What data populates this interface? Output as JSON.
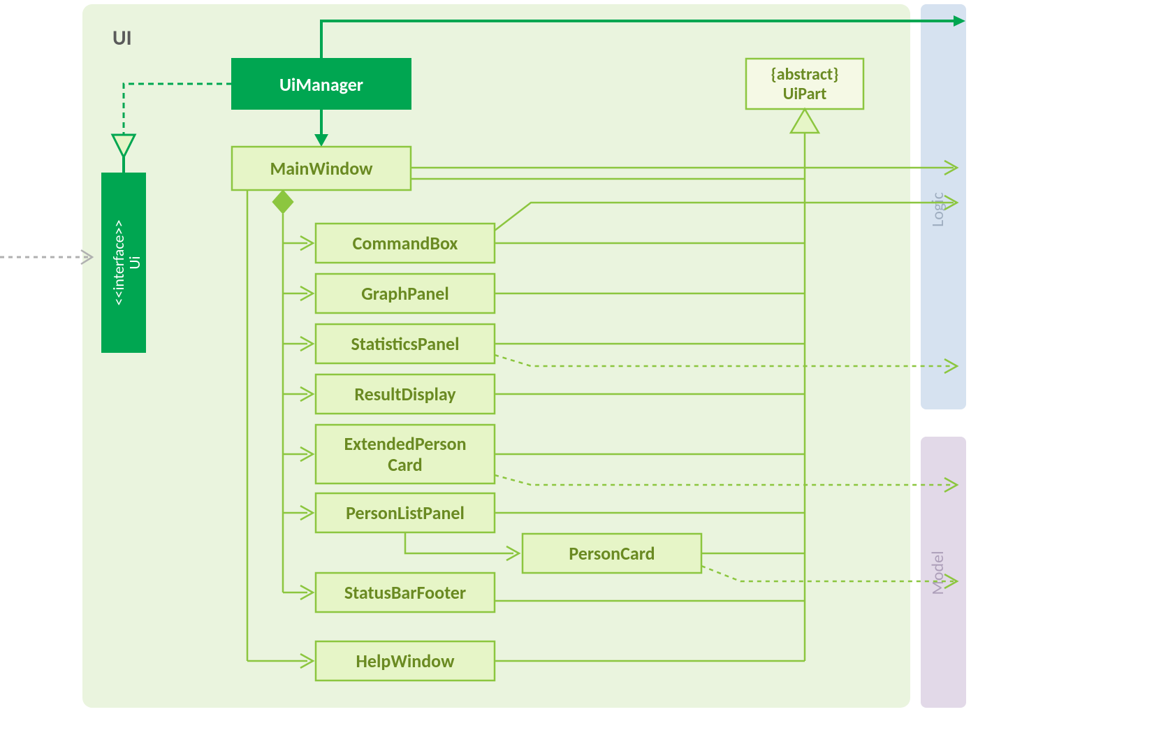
{
  "package": {
    "label": "UI"
  },
  "interface": {
    "stereotype": "<<interface>>",
    "name": "Ui"
  },
  "manager": {
    "name": "UiManager"
  },
  "mainwindow": {
    "name": "MainWindow"
  },
  "commandbox": {
    "name": "CommandBox"
  },
  "graphpanel": {
    "name": "GraphPanel"
  },
  "statisticspanel": {
    "name": "StatisticsPanel"
  },
  "resultdisplay": {
    "name": "ResultDisplay"
  },
  "extendedpersoncard": {
    "line1": "ExtendedPerson",
    "line2": "Card"
  },
  "personlistpanel": {
    "name": "PersonListPanel"
  },
  "personcard": {
    "name": "PersonCard"
  },
  "statusbarfooter": {
    "name": "StatusBarFooter"
  },
  "helpwindow": {
    "name": "HelpWindow"
  },
  "uipart": {
    "stereotype": "{abstract}",
    "name": "UiPart"
  },
  "external": {
    "logic": "Logic",
    "model": "Model"
  },
  "colors": {
    "darkGreen": "#00a651",
    "olive": "#8cc63f",
    "lightFill": "#e6f5c7",
    "pkgFill": "#eaf4de",
    "logicBox": "#d6e2f0",
    "modelBox": "#e2d9e8"
  }
}
